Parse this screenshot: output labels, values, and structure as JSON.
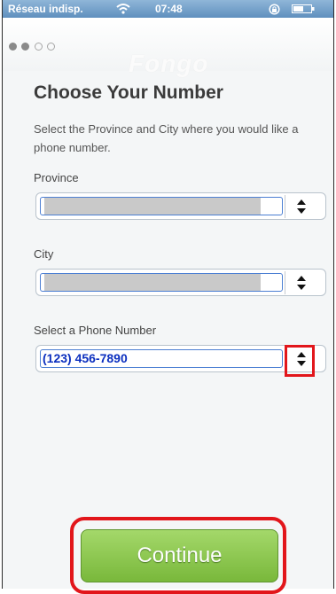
{
  "status_bar": {
    "carrier": "Réseau indisp.",
    "time": "07:48",
    "icons": [
      "wifi-icon",
      "lock-rotation-icon",
      "battery-icon"
    ]
  },
  "pager": {
    "total": 4,
    "active": 2
  },
  "screen": {
    "title": "Choose Your Number",
    "description": "Select the Province and City where you would like a phone number."
  },
  "province": {
    "label": "Province"
  },
  "city": {
    "label": "City"
  },
  "phone": {
    "label": "Select a Phone Number",
    "value": "(123) 456-7890"
  },
  "continue": {
    "label": "Continue"
  },
  "colors": {
    "highlight": "#e2161b",
    "button_green": "#86c24a",
    "phone_text": "#0b2fbf"
  }
}
